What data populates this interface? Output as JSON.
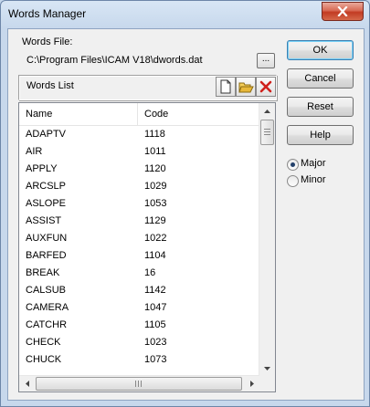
{
  "window": {
    "title": "Words Manager"
  },
  "words_file": {
    "label": "Words File:",
    "path": "C:\\Program Files\\ICAM V18\\dwords.dat",
    "browse_label": "..."
  },
  "words_list": {
    "label": "Words List",
    "columns": [
      "Name",
      "Code"
    ],
    "rows": [
      {
        "name": "ADAPTV",
        "code": "1118"
      },
      {
        "name": "AIR",
        "code": "1011"
      },
      {
        "name": "APPLY",
        "code": "1120"
      },
      {
        "name": "ARCSLP",
        "code": "1029"
      },
      {
        "name": "ASLOPE",
        "code": "1053"
      },
      {
        "name": "ASSIST",
        "code": "1129"
      },
      {
        "name": "AUXFUN",
        "code": "1022"
      },
      {
        "name": "BARFED",
        "code": "1104"
      },
      {
        "name": "BREAK",
        "code": "16"
      },
      {
        "name": "CALSUB",
        "code": "1142"
      },
      {
        "name": "CAMERA",
        "code": "1047"
      },
      {
        "name": "CATCHR",
        "code": "1105"
      },
      {
        "name": "CHECK",
        "code": "1023"
      },
      {
        "name": "CHUCK",
        "code": "1073"
      }
    ]
  },
  "toolbar": {
    "new_icon": "new-document-icon",
    "open_icon": "open-folder-icon",
    "delete_icon": "delete-x-icon"
  },
  "buttons": {
    "ok": "OK",
    "cancel": "Cancel",
    "reset": "Reset",
    "help": "Help"
  },
  "options": {
    "major": "Major",
    "minor": "Minor",
    "selected": "Major"
  },
  "colors": {
    "close_button": "#c23b23",
    "delete_icon": "#d0201c",
    "folder_icon": "#e8b83a"
  }
}
